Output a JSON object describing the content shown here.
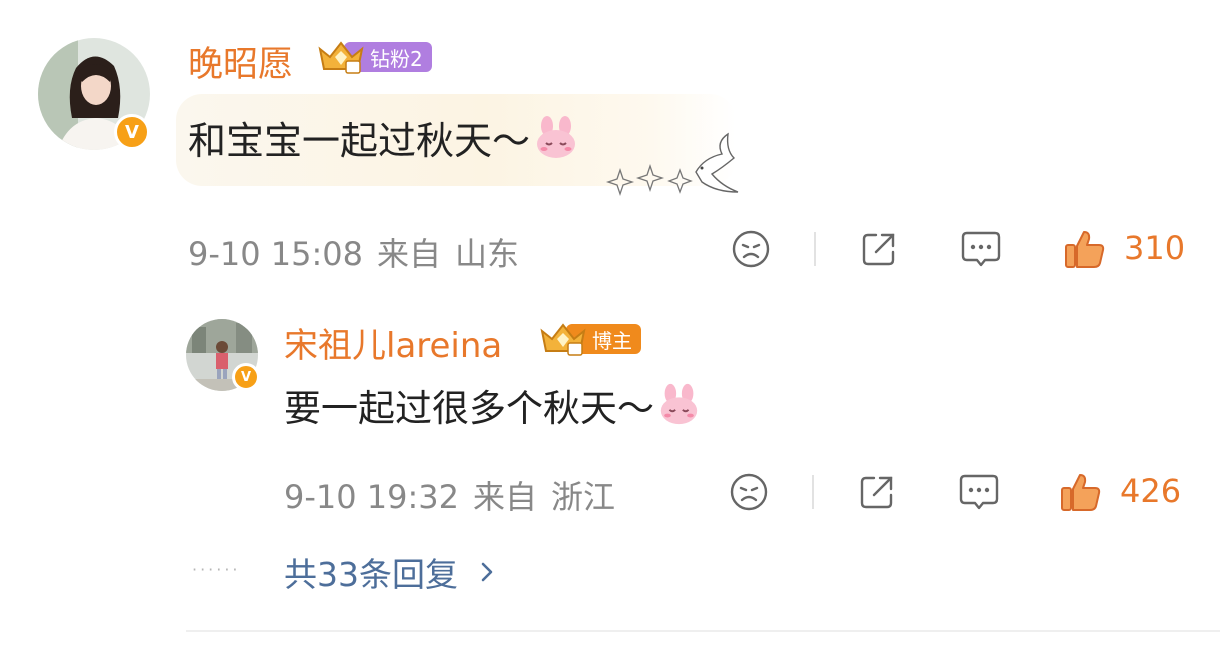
{
  "comment": {
    "username": "晚昭愿",
    "badge_label": "钻粉2",
    "content": "和宝宝一起过秋天～",
    "emoji": "bunny-blush-emoji",
    "date": "9-10 15:08",
    "source_prefix": "来自",
    "location": "山东",
    "like_count": "310"
  },
  "reply": {
    "username": "宋祖儿lareina",
    "badge_label": "博主",
    "content": "要一起过很多个秋天～",
    "emoji": "bunny-blush-emoji",
    "date": "9-10 19:32",
    "source_prefix": "来自",
    "location": "浙江",
    "like_count": "426"
  },
  "more_replies": "共33条回复",
  "colors": {
    "username": "#e8782b",
    "like_active": "#e8782b",
    "link": "#4d6e9a",
    "meta": "#888888",
    "badge_fan": "#b07ee0",
    "badge_blogger": "#f08a1c",
    "verified": "#f7a017"
  }
}
